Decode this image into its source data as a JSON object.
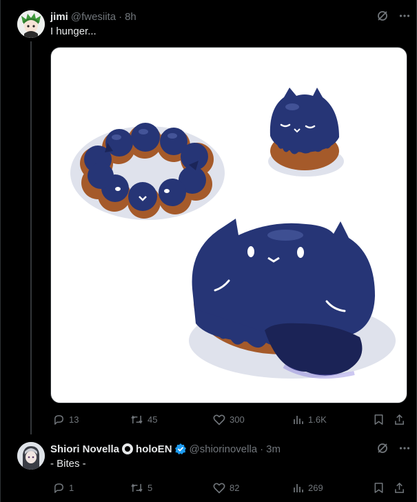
{
  "tweet1": {
    "display_name": "jimi",
    "handle": "@fwesiita",
    "separator": "·",
    "time": "8h",
    "text": "I hunger...",
    "replies": "13",
    "reposts": "45",
    "likes": "300",
    "views": "1.6K"
  },
  "tweet2": {
    "display_name": "Shiori Novella",
    "org": "holoEN",
    "handle": "@shiorinovella",
    "separator": "·",
    "time": "3m",
    "text": "- Bites -",
    "replies": "1",
    "reposts": "5",
    "likes": "82",
    "views": "269"
  },
  "icons": {
    "grok": "grok-icon",
    "more": "more-icon",
    "reply": "reply-icon",
    "repost": "repost-icon",
    "like": "like-icon",
    "views": "views-icon",
    "bookmark": "bookmark-icon",
    "share": "share-icon"
  },
  "colors": {
    "background": "#000000",
    "text": "#e7e9ea",
    "muted": "#71767b",
    "verified": "#1d9bf0",
    "donut_blue": "#2a3a7c",
    "donut_brown": "#a2582a"
  }
}
